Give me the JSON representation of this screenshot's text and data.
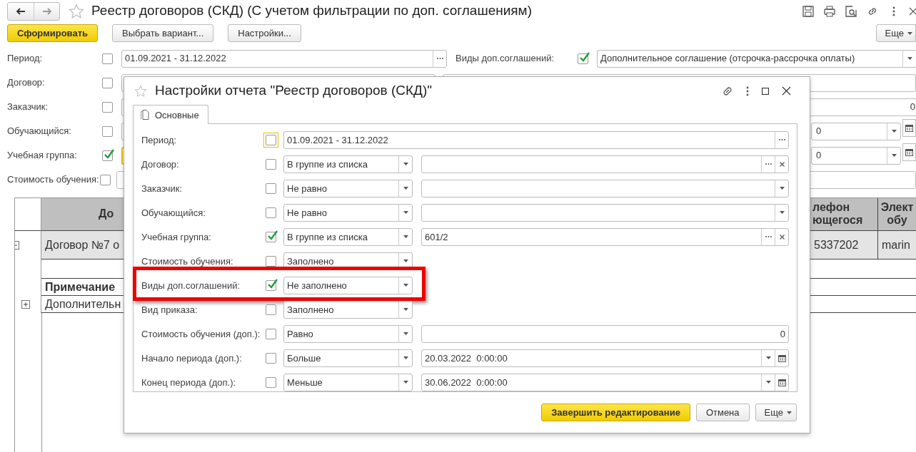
{
  "window": {
    "title": "Реестр договоров (СКД) (С учетом фильтрации по доп. соглашениям)"
  },
  "toolbar": {
    "buttons": [
      {
        "label": "Сформировать",
        "kind": "primary"
      },
      {
        "label": "Выбрать вариант...",
        "kind": "default"
      },
      {
        "label": "Настройки...",
        "kind": "default"
      }
    ],
    "more_button": "Еще"
  },
  "filters": [
    {
      "label": "Период:",
      "checked": false,
      "focused": false,
      "kind": "period",
      "value": "01.09.2021 - 31.12.2022"
    },
    {
      "label": "Договор:",
      "checked": false,
      "focused": false,
      "kind": "blank"
    },
    {
      "label": "Заказчик:",
      "checked": false,
      "focused": false,
      "kind": "number",
      "value": "0"
    },
    {
      "label": "Обучающийся:",
      "checked": false,
      "focused": false,
      "kind": "date",
      "value": "0"
    },
    {
      "label": "Учебная группа:",
      "checked": true,
      "focused": true,
      "kind": "date",
      "value": "0"
    },
    {
      "label": "Стоимость обучения:",
      "checked": false,
      "focused": false,
      "kind": "blank"
    }
  ],
  "side_filter": {
    "label": "Виды доп.соглашений:",
    "checked": true,
    "value": "Дополнительное соглашение (отсрочка-рассрочка оплаты)"
  },
  "table": {
    "columns": [
      {
        "lines": [
          "До"
        ]
      },
      {
        "lines": [
          "лефон",
          "ющегося"
        ]
      },
      {
        "lines": [
          "Элект",
          "обу"
        ]
      }
    ],
    "rows": [
      {
        "kind": "group",
        "expanded": true,
        "cells": [
          "Договор №7 о",
          "5337202",
          "marin"
        ],
        "children": [
          {
            "kind": "blank"
          },
          {
            "kind": "heading",
            "cells": [
              "Примечание"
            ]
          },
          {
            "kind": "item",
            "expanded": false,
            "cells": [
              "Дополнительн"
            ]
          }
        ]
      }
    ]
  },
  "dialog": {
    "title": "Настройки отчета \"Реестр договоров (СКД)\"",
    "tabs": [
      {
        "label": "Основные",
        "selected": true
      }
    ],
    "rows": [
      {
        "label": "Период:",
        "checked": false,
        "focused": true,
        "highlighted": false,
        "kind": "period",
        "value": "01.09.2021 - 31.12.2022"
      },
      {
        "label": "Договор:",
        "checked": false,
        "focused": false,
        "highlighted": false,
        "kind": "list",
        "operator": "В группе из списка"
      },
      {
        "label": "Заказчик:",
        "checked": false,
        "focused": false,
        "highlighted": false,
        "kind": "select",
        "operator": "Не равно"
      },
      {
        "label": "Обучающийся:",
        "checked": false,
        "focused": false,
        "highlighted": false,
        "kind": "select",
        "operator": "Не равно"
      },
      {
        "label": "Учебная группа:",
        "checked": true,
        "focused": false,
        "highlighted": false,
        "kind": "list",
        "operator": "В группе из списка",
        "value": "601/2"
      },
      {
        "label": "Стоимость обучения:",
        "checked": false,
        "focused": false,
        "highlighted": false,
        "kind": "operator",
        "operator": "Заполнено"
      },
      {
        "label": "Виды доп.соглашений:",
        "checked": true,
        "focused": false,
        "highlighted": true,
        "kind": "operator",
        "operator": "Не заполнено"
      },
      {
        "label": "Вид приказа:",
        "checked": false,
        "focused": false,
        "highlighted": false,
        "kind": "operator",
        "operator": "Заполнено"
      },
      {
        "label": "Стоимость обучения (доп.):",
        "checked": false,
        "focused": false,
        "highlighted": false,
        "kind": "number",
        "operator": "Равно",
        "value": "0"
      },
      {
        "label": "Начало периода (доп.):",
        "checked": false,
        "focused": false,
        "highlighted": false,
        "kind": "date",
        "operator": "Больше",
        "value": "20.03.2022  0:00:00"
      },
      {
        "label": "Конец периода (доп.):",
        "checked": false,
        "focused": false,
        "highlighted": false,
        "kind": "date",
        "operator": "Меньше",
        "value": "30.06.2022  0:00:00"
      }
    ],
    "buttons": [
      {
        "label": "Завершить редактирование",
        "kind": "primary"
      },
      {
        "label": "Отмена",
        "kind": "default"
      },
      {
        "label": "Еще",
        "kind": "menu"
      }
    ]
  }
}
